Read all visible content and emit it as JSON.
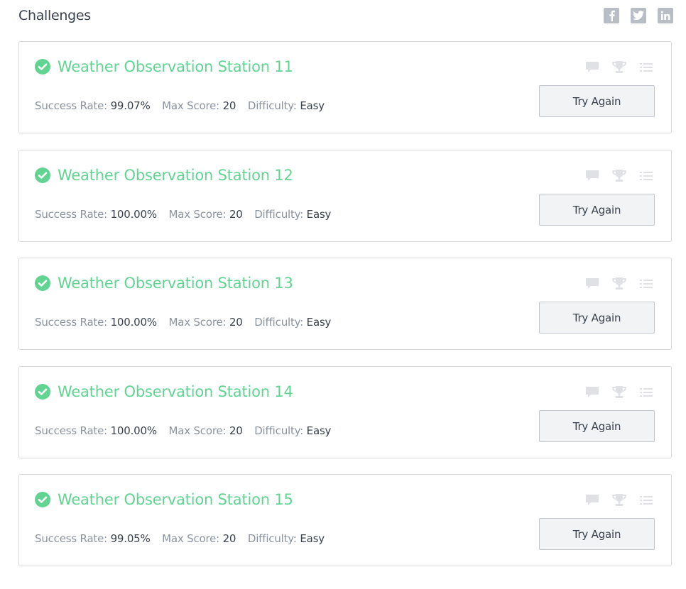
{
  "header": {
    "title": "Challenges",
    "social": [
      {
        "name": "facebook-icon"
      },
      {
        "name": "twitter-icon"
      },
      {
        "name": "linkedin-icon"
      }
    ]
  },
  "labels": {
    "success_rate": "Success Rate:",
    "max_score": "Max Score:",
    "difficulty": "Difficulty:",
    "button": "Try Again"
  },
  "colors": {
    "solved_green": "#62d491",
    "icon_gray": "#dfe1e5",
    "label_gray": "#8b93a0",
    "text_dark": "#39424e"
  },
  "challenges": [
    {
      "title": "Weather Observation Station 11",
      "success_rate": "99.07%",
      "max_score": "20",
      "difficulty": "Easy"
    },
    {
      "title": "Weather Observation Station 12",
      "success_rate": "100.00%",
      "max_score": "20",
      "difficulty": "Easy"
    },
    {
      "title": "Weather Observation Station 13",
      "success_rate": "100.00%",
      "max_score": "20",
      "difficulty": "Easy"
    },
    {
      "title": "Weather Observation Station 14",
      "success_rate": "100.00%",
      "max_score": "20",
      "difficulty": "Easy"
    },
    {
      "title": "Weather Observation Station 15",
      "success_rate": "99.05%",
      "max_score": "20",
      "difficulty": "Easy"
    }
  ]
}
